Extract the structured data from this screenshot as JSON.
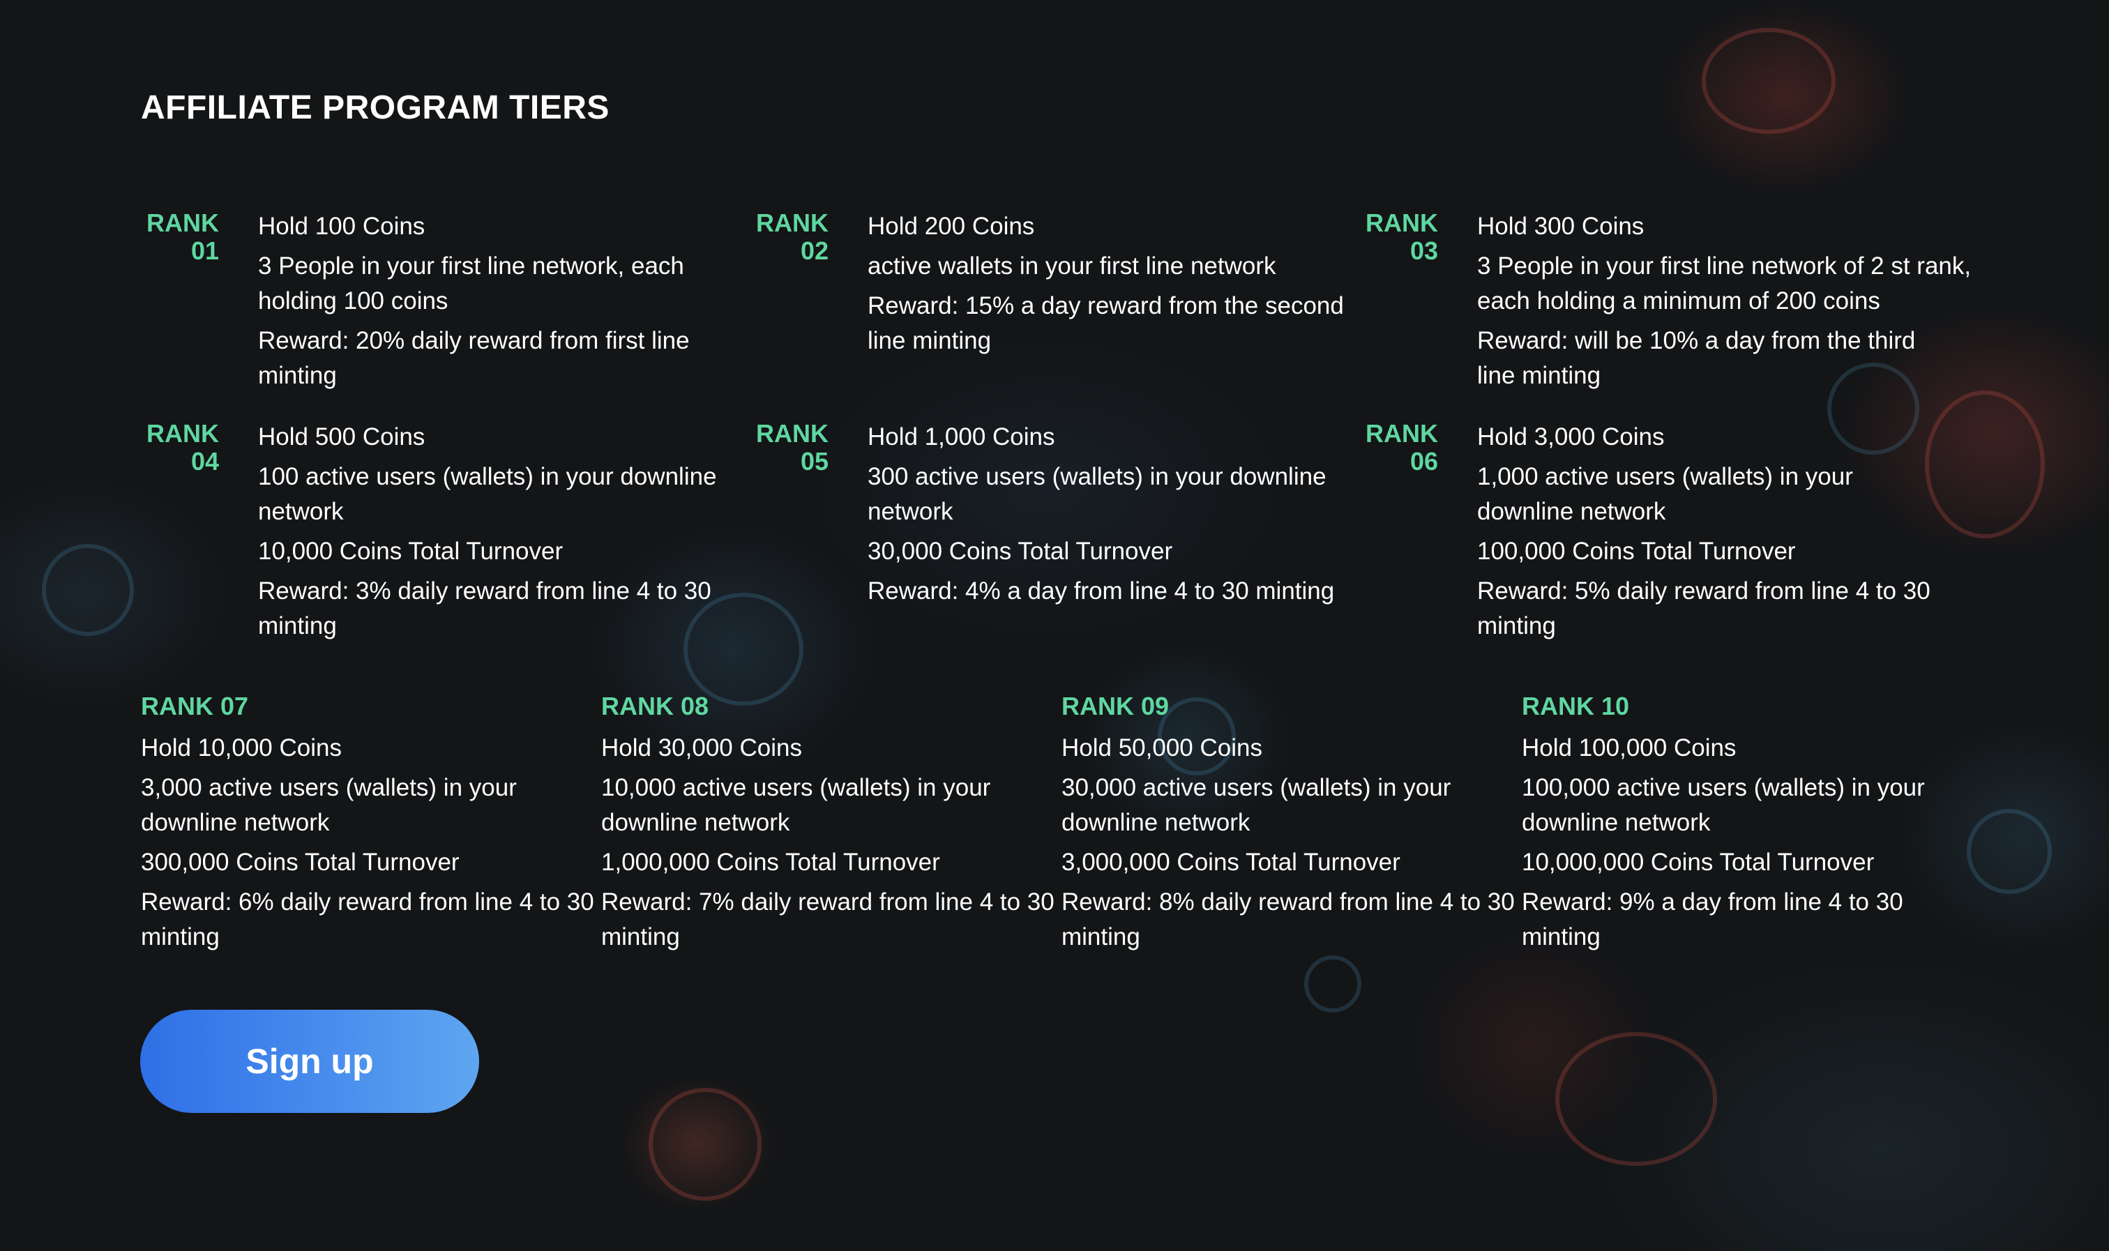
{
  "title": "AFFILIATE PROGRAM TIERS",
  "ranks": [
    {
      "word": "RANK",
      "num": "01",
      "lines": [
        "Hold 100 Coins",
        "3 People in your first line network, each holding 100 coins",
        "Reward: 20% daily reward from first line minting"
      ]
    },
    {
      "word": "RANK",
      "num": "02",
      "lines": [
        "Hold 200 Coins",
        "active wallets in your first line network",
        "Reward: 15% a day reward from the second line minting"
      ]
    },
    {
      "word": "RANK",
      "num": "03",
      "lines": [
        "Hold 300 Coins",
        "3 People in your first line network of 2 st rank, each holding a minimum of 200 coins",
        "Reward: will be 10% a day from the third line minting"
      ]
    },
    {
      "word": "RANK",
      "num": "04",
      "lines": [
        "Hold 500 Coins",
        "100 active users (wallets) in your downline network",
        "10,000 Coins Total Turnover",
        "Reward: 3% daily reward from line 4 to 30 minting"
      ]
    },
    {
      "word": "RANK",
      "num": "05",
      "lines": [
        "Hold 1,000 Coins",
        "300 active users (wallets) in your downline network",
        "30,000 Coins Total Turnover",
        "Reward: 4% a day from line 4 to 30 minting"
      ]
    },
    {
      "word": "RANK",
      "num": "06",
      "lines": [
        "Hold 3,000 Coins",
        "1,000 active users (wallets) in your downline network",
        "100,000 Coins Total Turnover",
        "Reward: 5% daily reward from line 4 to 30 minting"
      ]
    },
    {
      "label": "RANK 07",
      "lines": [
        "Hold 10,000 Coins",
        "3,000 active users (wallets) in your downline network",
        "300,000 Coins Total Turnover",
        "Reward: 6% daily reward from line 4 to 30 minting"
      ]
    },
    {
      "label": "RANK 08",
      "lines": [
        "Hold 30,000 Coins",
        "10,000 active users (wallets) in your downline network",
        "1,000,000 Coins Total Turnover",
        "Reward: 7% daily reward from line 4 to 30 minting"
      ]
    },
    {
      "label": "RANK 09",
      "lines": [
        "Hold 50,000 Coins",
        "30,000 active users (wallets) in your downline network",
        "3,000,000 Coins Total Turnover",
        "Reward: 8% daily reward from line 4 to 30 minting"
      ]
    },
    {
      "label": "RANK 10",
      "lines": [
        "Hold 100,000 Coins",
        "100,000 active users (wallets) in your downline network",
        "10,000,000 Coins Total Turnover",
        "Reward: 9% a day from line 4 to 30 minting"
      ]
    }
  ],
  "signup_label": "Sign up",
  "colors": {
    "accent": "#5fd7a0",
    "button_start": "#2f6fe6",
    "button_end": "#5ea6f0",
    "background": "#131517"
  }
}
